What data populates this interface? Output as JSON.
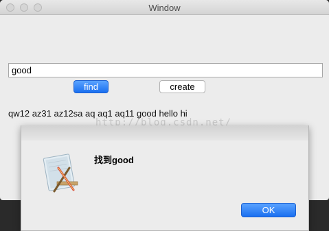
{
  "window": {
    "title": "Window"
  },
  "search": {
    "value": "good"
  },
  "buttons": {
    "find_label": "find",
    "create_label": "create"
  },
  "word_list": "qw12 az31 az12sa aq aq1 aq11 good hello hi",
  "watermark": "http://blog.csdn.net/",
  "alert": {
    "message": "找到good",
    "ok_label": "OK",
    "icon": "app-icon"
  },
  "colors": {
    "accent": "#1a6ff0",
    "window_bg": "#ececec"
  }
}
